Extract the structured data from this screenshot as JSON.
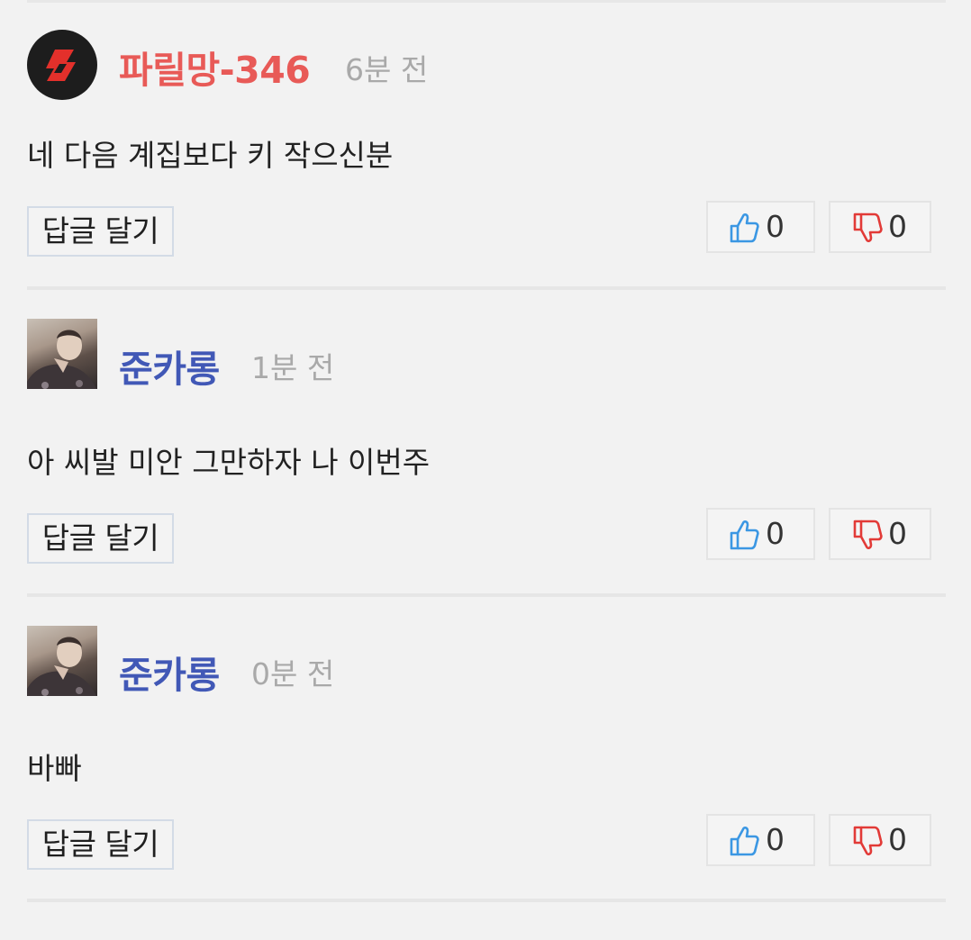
{
  "colors": {
    "author_red": "#e85a57",
    "author_blue": "#4158b6",
    "like_blue": "#3b97e3",
    "dislike_red": "#e23a37"
  },
  "comments": [
    {
      "author": "파릴망-346",
      "time": "6분 전",
      "text": "네 다음 계집보다 키 작으신분",
      "reply_label": "답글 달기",
      "likes": "0",
      "dislikes": "0",
      "avatar_icon": "brand-logo-icon"
    },
    {
      "author": "준카롱",
      "time": "1분 전",
      "text": "아 씨발 미안 그만하자 나 이번주",
      "reply_label": "답글 달기",
      "likes": "0",
      "dislikes": "0",
      "avatar_icon": "user-photo"
    },
    {
      "author": "준카롱",
      "time": "0분 전",
      "text": "바빠",
      "reply_label": "답글 달기",
      "likes": "0",
      "dislikes": "0",
      "avatar_icon": "user-photo"
    }
  ]
}
